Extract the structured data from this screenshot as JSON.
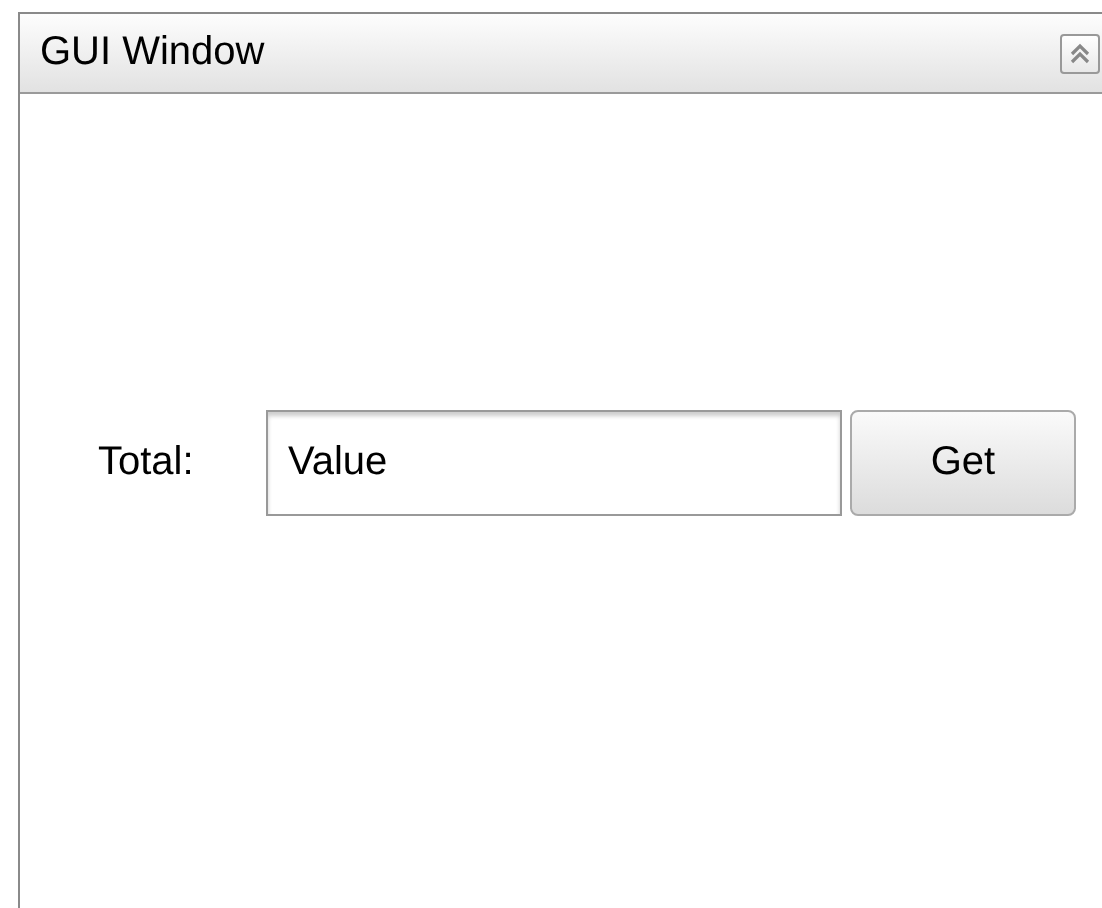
{
  "window": {
    "title": "GUI Window",
    "collapsible": true
  },
  "form": {
    "label": "Total:",
    "field": {
      "value": "Value"
    },
    "button": "Get"
  }
}
